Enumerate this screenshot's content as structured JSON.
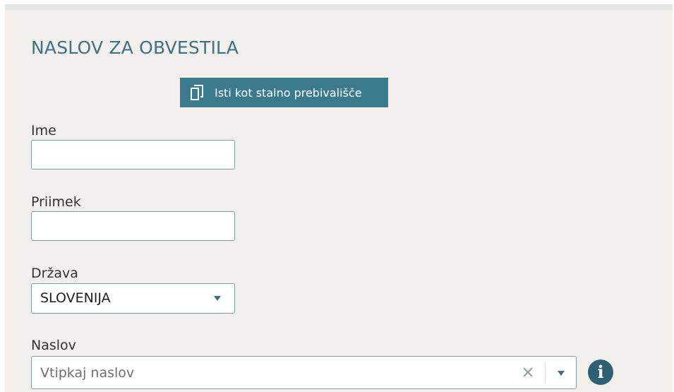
{
  "section": {
    "title": "NASLOV ZA OBVESTILA"
  },
  "copy_button": {
    "label": "Isti kot stalno prebivališče",
    "icon": "copy-icon"
  },
  "fields": {
    "ime": {
      "label": "Ime",
      "value": ""
    },
    "priimek": {
      "label": "Priimek",
      "value": ""
    },
    "drzava": {
      "label": "Država",
      "value": "SLOVENIJA",
      "icon": "chevron-down-icon"
    },
    "naslov": {
      "label": "Naslov",
      "placeholder": "Vtipkaj naslov",
      "clear_icon": "close-icon",
      "dropdown_icon": "chevron-down-icon"
    }
  },
  "info": {
    "icon": "info-icon",
    "glyph": "i"
  },
  "colors": {
    "panel_bg": "#f2efec",
    "accent": "#3b7a8c",
    "title": "#3f7286",
    "info": "#2f5f73"
  }
}
